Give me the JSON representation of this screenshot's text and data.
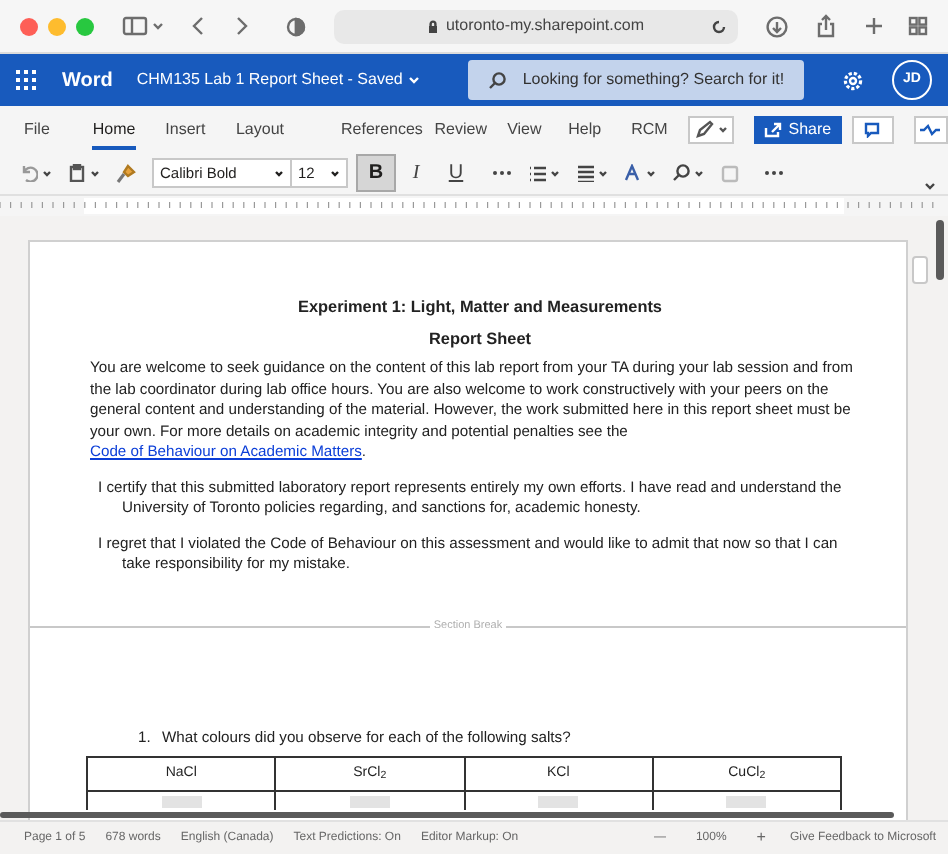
{
  "browser": {
    "url": "utoronto-my.sharepoint.com"
  },
  "app_bar": {
    "app": "Word",
    "document_title": "CHM135 Lab 1 Report Sheet",
    "separator": "-",
    "save_state": "Saved",
    "search_placeholder": "Looking for something? Search for it!",
    "avatar_initials": "JD"
  },
  "ribbon_tabs": [
    {
      "label": "File",
      "selected": false
    },
    {
      "label": "Home",
      "selected": true
    },
    {
      "label": "Insert",
      "selected": false
    },
    {
      "label": "Layout",
      "selected": false
    },
    {
      "label": "References",
      "selected": false
    },
    {
      "label": "Review",
      "selected": false
    },
    {
      "label": "View",
      "selected": false
    },
    {
      "label": "Help",
      "selected": false
    },
    {
      "label": "RCM",
      "selected": false
    }
  ],
  "share_button": "Share",
  "toolbar": {
    "font_name": "Calibri Bold",
    "font_size": "12",
    "format_buttons": [
      {
        "label": "B",
        "selected": true
      },
      {
        "label": "I",
        "selected": false
      },
      {
        "label": "U",
        "selected": false
      }
    ]
  },
  "document": {
    "title": "Experiment 1: Light, Matter and Measurements",
    "subtitle": "Report Sheet",
    "intro": "You are welcome to seek guidance on the content of this lab report from your TA during your lab session and from the lab coordinator during lab office hours.  You are also welcome to work constructively with your peers on the general content and understanding of the material.  However, the work submitted here in this report sheet must be your own. For more details on academic integrity and potential penalties see the ",
    "intro_link": "Code of Behaviour on Academic Matters",
    "intro_end": ".",
    "statements": [
      "I certify that this submitted laboratory report represents entirely my own efforts. I have read and understand the University of Toronto policies regarding, and sanctions for, academic honesty.",
      "I regret that I violated the Code of Behaviour on this assessment and would like to admit that now so that I can take responsibility for my mistake."
    ],
    "section_break": "Section Break",
    "question_number": "1.",
    "question": "What colours did you observe for each of the following salts?",
    "table": {
      "columns": [
        "NaCl",
        "SrCl$_{2}$",
        "KCl",
        "CuCl$_{2}$"
      ]
    }
  },
  "status_bar": {
    "page": "Page 1 of 5",
    "words": "678 words",
    "language": "English (Canada)",
    "text_predictions": "Text Predictions: On",
    "editor_markup": "Editor Markup: On",
    "zoom_out": "—",
    "zoom": "100%",
    "zoom_in": "+",
    "feedback": "Give Feedback to Microsoft"
  }
}
